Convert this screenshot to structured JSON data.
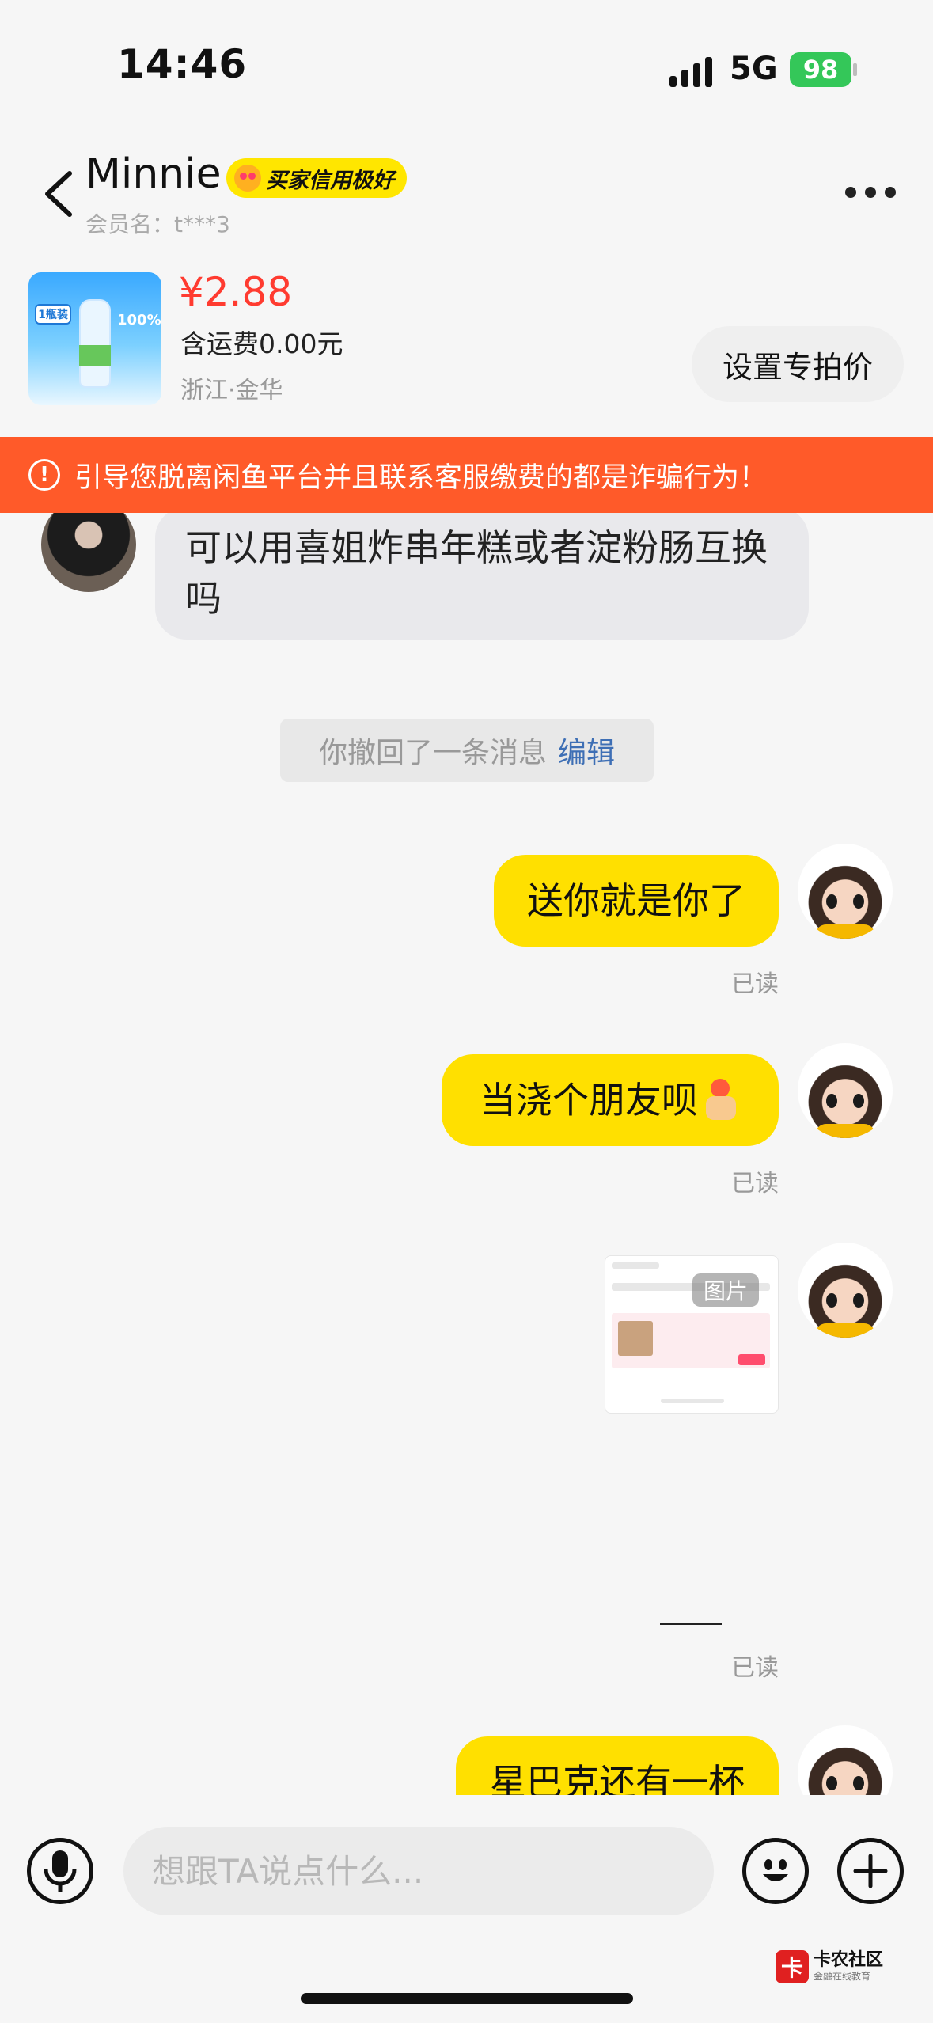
{
  "status_bar": {
    "time": "14:46",
    "network": "5G",
    "battery": "98"
  },
  "header": {
    "name": "Minnie",
    "credit_badge": "买家信用极好",
    "member_id": "会员名：t***3"
  },
  "product": {
    "price": "¥2.88",
    "shipping": "含运费0.00元",
    "location": "浙江·金华",
    "special_price_button": "设置专拍价",
    "thumb_tag": "1瓶装",
    "thumb_percent": "100%"
  },
  "warning": {
    "icon_text": "!",
    "text": "引导您脱离闲鱼平台并且联系客服缴费的都是诈骗行为！"
  },
  "messages": {
    "incoming_1": "可以用喜姐炸串年糕或者淀粉肠互换吗",
    "recall_notice": "你撤回了一条消息",
    "recall_edit": "编辑",
    "outgoing_1": "送你就是你了",
    "outgoing_2": "当浇个朋友呗",
    "image_tag": "图片",
    "outgoing_3": "星巴克还有一杯",
    "read_label": "已读"
  },
  "input": {
    "placeholder": "想跟TA说点什么..."
  },
  "watermark": {
    "logo": "卡",
    "title": "卡农社区",
    "subtitle": "金融在线教育"
  },
  "colors": {
    "accent": "#ffe000",
    "warning": "#ff5a29",
    "price": "#ff3b30",
    "link": "#3e6fb5"
  }
}
